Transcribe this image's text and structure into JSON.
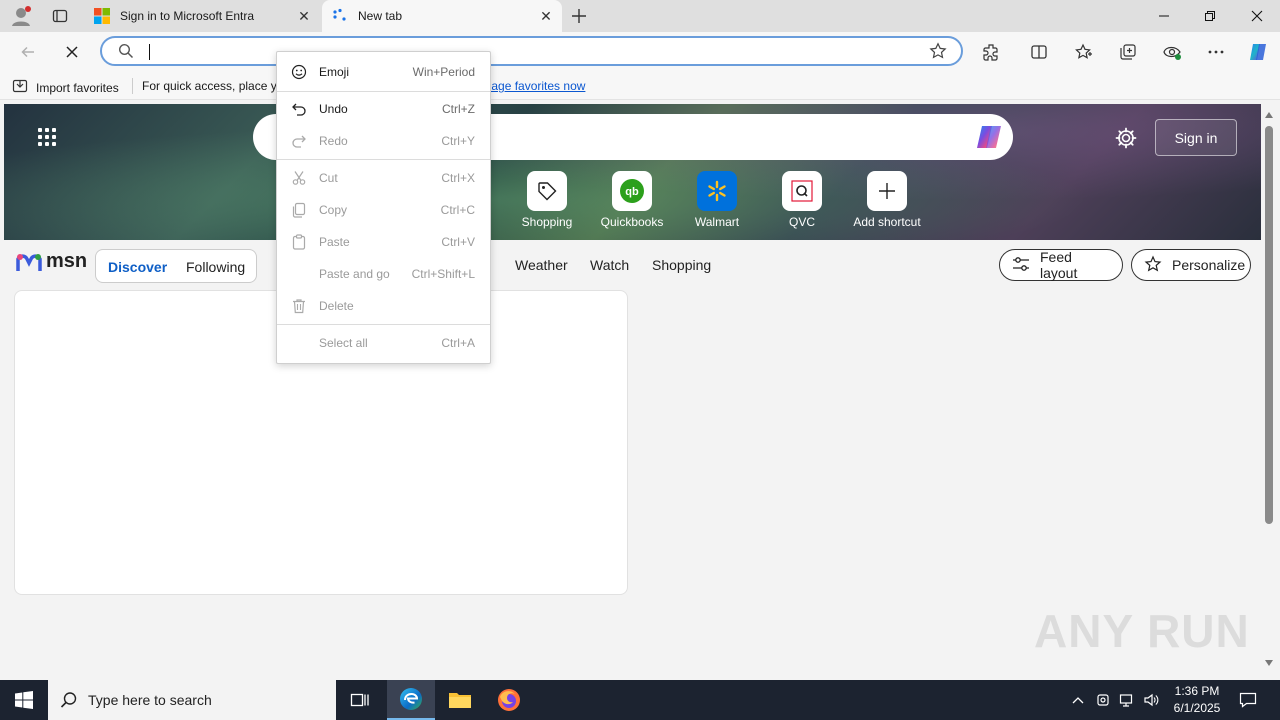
{
  "browser": {
    "tabs": [
      {
        "label": "Sign in to Microsoft Entra",
        "active": false
      },
      {
        "label": "New tab",
        "active": true
      }
    ],
    "address_value": ""
  },
  "favorites_bar": {
    "import_label": "Import favorites",
    "hint_text": "For quick access, place yo",
    "manage_link": "anage favorites now"
  },
  "context_menu": {
    "items": [
      {
        "label": "Emoji",
        "shortcut": "Win+Period",
        "enabled": true,
        "icon": "emoji-icon"
      },
      {
        "label": "Undo",
        "shortcut": "Ctrl+Z",
        "enabled": true,
        "icon": "undo-icon"
      },
      {
        "label": "Redo",
        "shortcut": "Ctrl+Y",
        "enabled": false,
        "icon": "redo-icon"
      },
      {
        "label": "Cut",
        "shortcut": "Ctrl+X",
        "enabled": false,
        "icon": "cut-icon"
      },
      {
        "label": "Copy",
        "shortcut": "Ctrl+C",
        "enabled": false,
        "icon": "copy-icon"
      },
      {
        "label": "Paste",
        "shortcut": "Ctrl+V",
        "enabled": false,
        "icon": "paste-icon"
      },
      {
        "label": "Paste and go",
        "shortcut": "Ctrl+Shift+L",
        "enabled": false,
        "icon": ""
      },
      {
        "label": "Delete",
        "shortcut": "",
        "enabled": false,
        "icon": "delete-icon"
      },
      {
        "label": "Select all",
        "shortcut": "Ctrl+A",
        "enabled": false,
        "icon": ""
      }
    ]
  },
  "newtab": {
    "sign_in": "Sign in",
    "shortcuts": [
      {
        "label": "Shopping",
        "icon": "tag-icon"
      },
      {
        "label": "Quickbooks",
        "icon": "quickbooks-icon"
      },
      {
        "label": "Walmart",
        "icon": "walmart-icon"
      },
      {
        "label": "QVC",
        "icon": "qvc-icon"
      },
      {
        "label": "Add shortcut",
        "icon": "plus-icon"
      }
    ],
    "msn_logo": "msn",
    "feed_tabs": {
      "discover": "Discover",
      "following": "Following"
    },
    "nav_links": [
      "Weather",
      "Watch",
      "Shopping"
    ],
    "feed_layout": "Feed layout",
    "personalize": "Personalize"
  },
  "watermark": "ANY RUN",
  "taskbar": {
    "search_placeholder": "Type here to search",
    "time": "1:36 PM",
    "date": "6/1/2025"
  },
  "colors": {
    "accent": "#0f5fc6",
    "omnibox_focus": "#6a9ddb",
    "taskbar": "#1c2330"
  }
}
